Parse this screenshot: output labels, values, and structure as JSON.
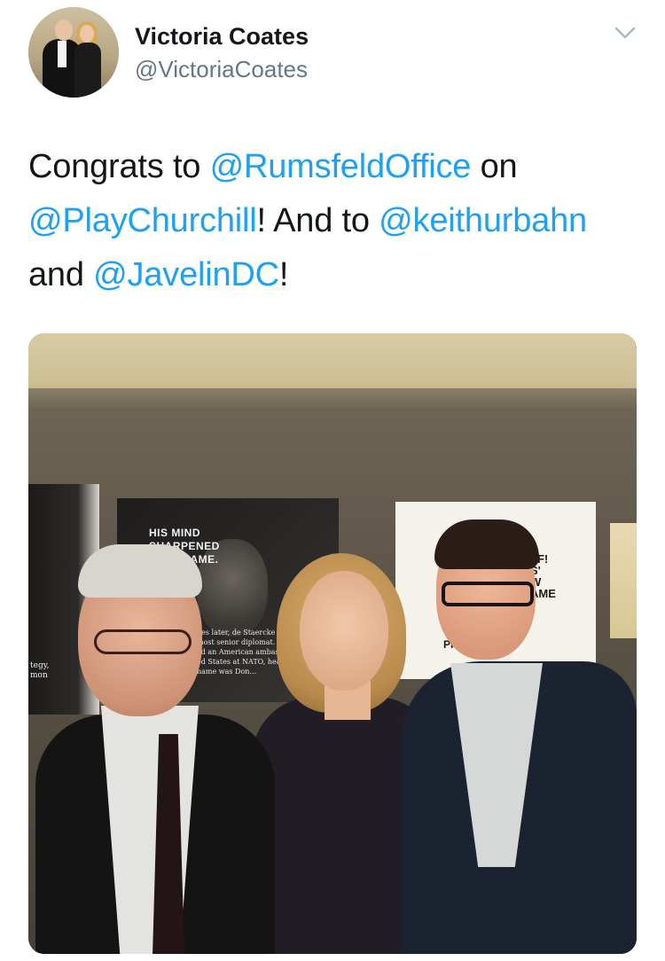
{
  "tweet": {
    "author": {
      "name": "Victoria Coates",
      "handle": "@VictoriaCoates"
    },
    "text": {
      "part1": "Congrats to ",
      "mention1": "@RumsfeldOffice",
      "part2": " on",
      "mention2": "@PlayChurchill",
      "part3": "!  And to ",
      "mention3": "@keithurbahn",
      "part4": "and ",
      "mention4": "@JavelinDC",
      "part5": "!"
    },
    "media": {
      "poster_center_title": "HIS MIND\nSHARPENED\n...H A GAME.",
      "poster_center_small": "des later, de Staercke had\nmost senior diplomat. In\ned an American ambassador\ned States at NATO, headquarters\nname was Don...",
      "poster_left_text": "tegy,\nmon",
      "poster_right_text1": "FF!\nS'\nW\nAME",
      "poster_right_text2": "PHI"
    }
  },
  "colors": {
    "text": "#14171a",
    "secondary": "#657786",
    "link": "#1da1f2"
  }
}
